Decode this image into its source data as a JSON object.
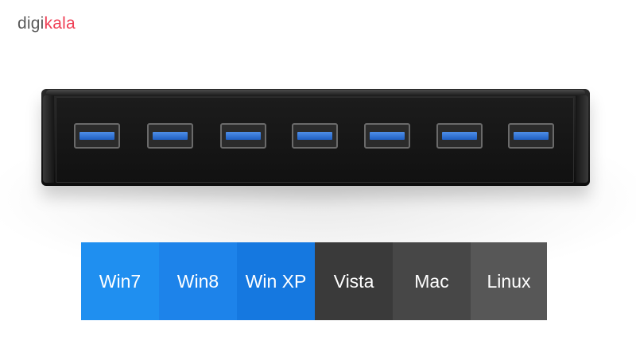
{
  "logo": {
    "part1": "digi",
    "part2": "kala",
    "brand_color": "#ef4056"
  },
  "product": {
    "ports": 7,
    "port_color": "#2f6fd6",
    "body_color": "#151515"
  },
  "os_labels": [
    {
      "label": "Win7",
      "color": "#1f8ff0"
    },
    {
      "label": "Win8",
      "color": "#1d83ea"
    },
    {
      "label": "Win XP",
      "color": "#1578e0"
    },
    {
      "label": "Vista",
      "color": "#3a3a3a"
    },
    {
      "label": "Mac",
      "color": "#474747"
    },
    {
      "label": "Linux",
      "color": "#575757"
    }
  ]
}
